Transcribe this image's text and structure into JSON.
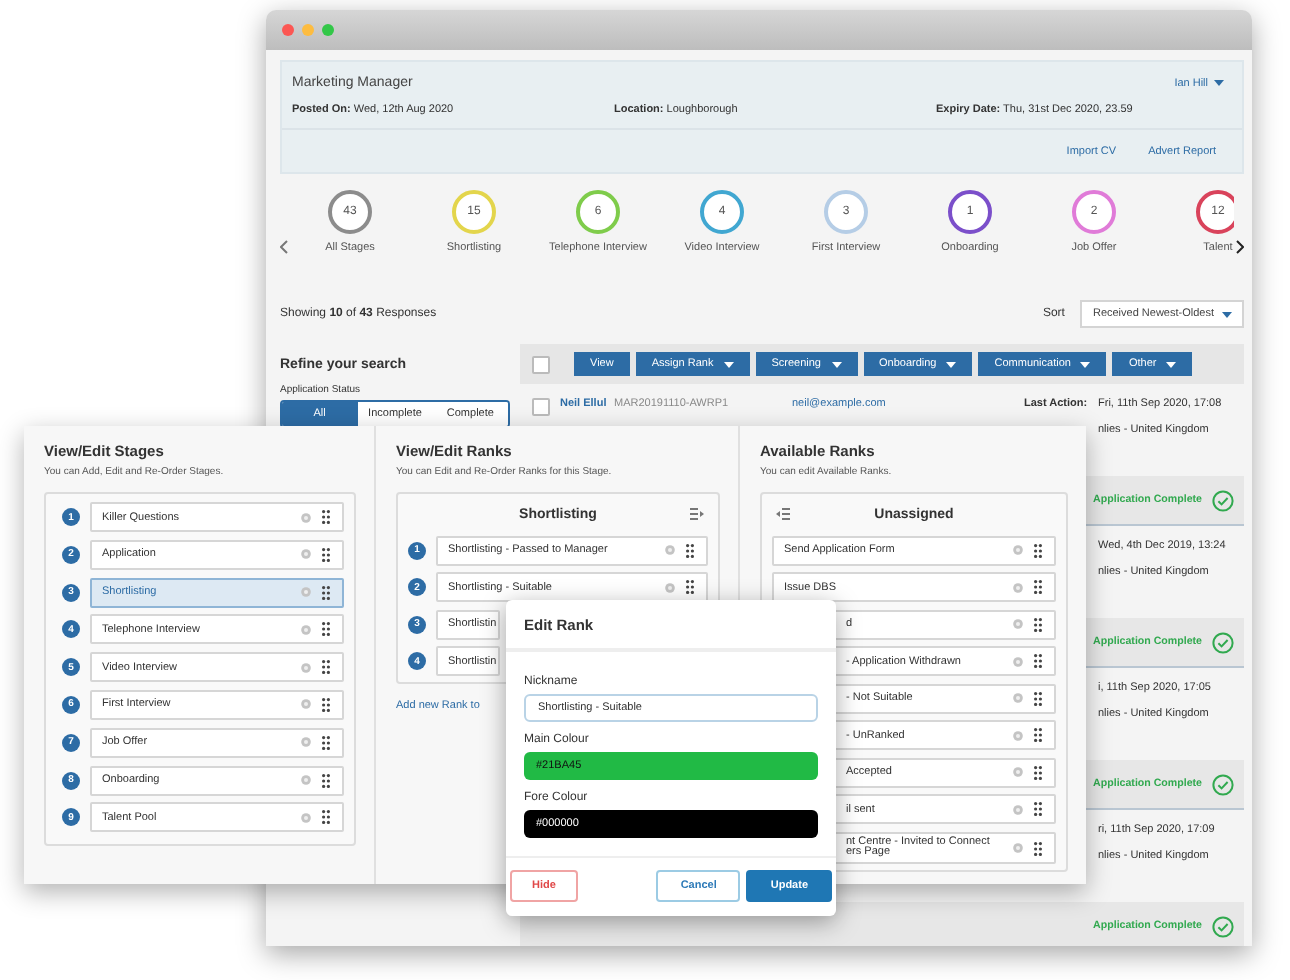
{
  "back_window": {
    "header": {
      "title": "Marketing Manager",
      "user": "Ian Hill",
      "posted_label": "Posted On:",
      "posted": "Wed, 12th Aug 2020",
      "location_label": "Location:",
      "location": "Loughborough",
      "expiry_label": "Expiry Date:",
      "expiry": "Thu, 31st Dec 2020, 23.59",
      "links": [
        "Import CV",
        "Advert Report"
      ]
    },
    "stages": [
      {
        "count": "43",
        "label": "All Stages",
        "color": "#8c8c8c"
      },
      {
        "count": "15",
        "label": "Shortlisting",
        "color": "#e3d54c"
      },
      {
        "count": "6",
        "label": "Telephone Interview",
        "color": "#7fcc4b"
      },
      {
        "count": "4",
        "label": "Video Interview",
        "color": "#41a7d1"
      },
      {
        "count": "3",
        "label": "First Interview",
        "color": "#b5cde6"
      },
      {
        "count": "1",
        "label": "Onboarding",
        "color": "#7b4fca"
      },
      {
        "count": "2",
        "label": "Job Offer",
        "color": "#e07bd8"
      },
      {
        "count": "12",
        "label": "Talent",
        "color": "#d9435b"
      }
    ],
    "summary": "Showing **10** of **43** Responses",
    "sort": {
      "label": "Sort",
      "value": "Received Newest-Oldest"
    },
    "sidebar": {
      "title": "Refine your search",
      "status_label": "Application Status",
      "segments": [
        {
          "label": "All",
          "selected": true
        },
        {
          "label": "Incomplete",
          "selected": false
        },
        {
          "label": "Complete",
          "selected": false
        }
      ]
    },
    "select_all": {
      "checked": false
    },
    "toolbar": [
      {
        "label": "View",
        "dropdown": false
      },
      {
        "label": "Assign Rank",
        "dropdown": true
      },
      {
        "label": "Screening",
        "dropdown": true
      },
      {
        "label": "Onboarding",
        "dropdown": true
      },
      {
        "label": "Communication",
        "dropdown": true
      },
      {
        "label": "Other",
        "dropdown": true
      }
    ],
    "responses": [
      {
        "checked": false,
        "name": "Neil Ellul",
        "ref": "MAR20191110-AWRP1",
        "email": "neil@example.com",
        "last_action_label": "Last Action:",
        "last_action": "Fri, 11th Sep 2020, 17:08",
        "location": "nlies - United Kingdom",
        "status": "Application Complete"
      },
      {
        "last_action": "Wed, 4th Dec 2019, 13:24",
        "location": "nlies - United Kingdom",
        "status": "Application Complete"
      },
      {
        "last_action": "i, 11th Sep 2020, 17:05",
        "location": "nlies - United Kingdom",
        "status": "Application Complete"
      },
      {
        "last_action": "ri, 11th Sep 2020, 17:09",
        "location": "nlies - United Kingdom",
        "status": "Application Complete"
      }
    ]
  },
  "stages_editor": {
    "stages_column": {
      "title": "View/Edit Stages",
      "subtitle": "You can Add, Edit and Re-Order Stages.",
      "items": [
        {
          "number": "1",
          "label": "Killer Questions",
          "selected": false
        },
        {
          "number": "2",
          "label": "Application",
          "selected": false
        },
        {
          "number": "3",
          "label": "Shortlisting",
          "selected": true
        },
        {
          "number": "4",
          "label": "Telephone Interview",
          "selected": false
        },
        {
          "number": "5",
          "label": "Video Interview",
          "selected": false
        },
        {
          "number": "6",
          "label": "First Interview",
          "selected": false
        },
        {
          "number": "7",
          "label": "Job Offer",
          "selected": false
        },
        {
          "number": "8",
          "label": "Onboarding",
          "selected": false
        },
        {
          "number": "9",
          "label": "Talent Pool",
          "selected": false
        }
      ]
    },
    "ranks_column": {
      "title": "View/Edit Ranks",
      "subtitle": "You can Edit and Re-Order Ranks for this Stage.",
      "heading": "Shortlisting",
      "items": [
        {
          "number": "1",
          "label": "Shortlisting - Passed to Manager"
        },
        {
          "number": "2",
          "label": "Shortlisting - Suitable"
        },
        {
          "number": "3",
          "label": "Shortlistin"
        },
        {
          "number": "4",
          "label": "Shortlistin"
        }
      ],
      "add_link": "Add new Rank to"
    },
    "available_column": {
      "title": "Available Ranks",
      "subtitle": "You can edit Available Ranks.",
      "heading": "Unassigned",
      "items": [
        "Send Application Form",
        "Issue DBS",
        "d",
        "- Application Withdrawn",
        "- Not Suitable",
        "- UnRanked",
        "Accepted",
        "il sent",
        "nt Centre - Invited to Connect\ners Page"
      ]
    }
  },
  "edit_rank": {
    "title": "Edit Rank",
    "fields": [
      {
        "kind": "text",
        "label": "Nickname",
        "value": "Shortlisting - Suitable"
      },
      {
        "kind": "color",
        "label": "Main Colour",
        "value": "#21BA45"
      },
      {
        "kind": "color",
        "label": "Fore Colour",
        "value": "#000000"
      }
    ],
    "buttons": [
      {
        "label": "Hide",
        "kind": "danger"
      },
      {
        "label": "Cancel",
        "kind": "secondary"
      },
      {
        "label": "Update",
        "kind": "primary"
      }
    ]
  }
}
